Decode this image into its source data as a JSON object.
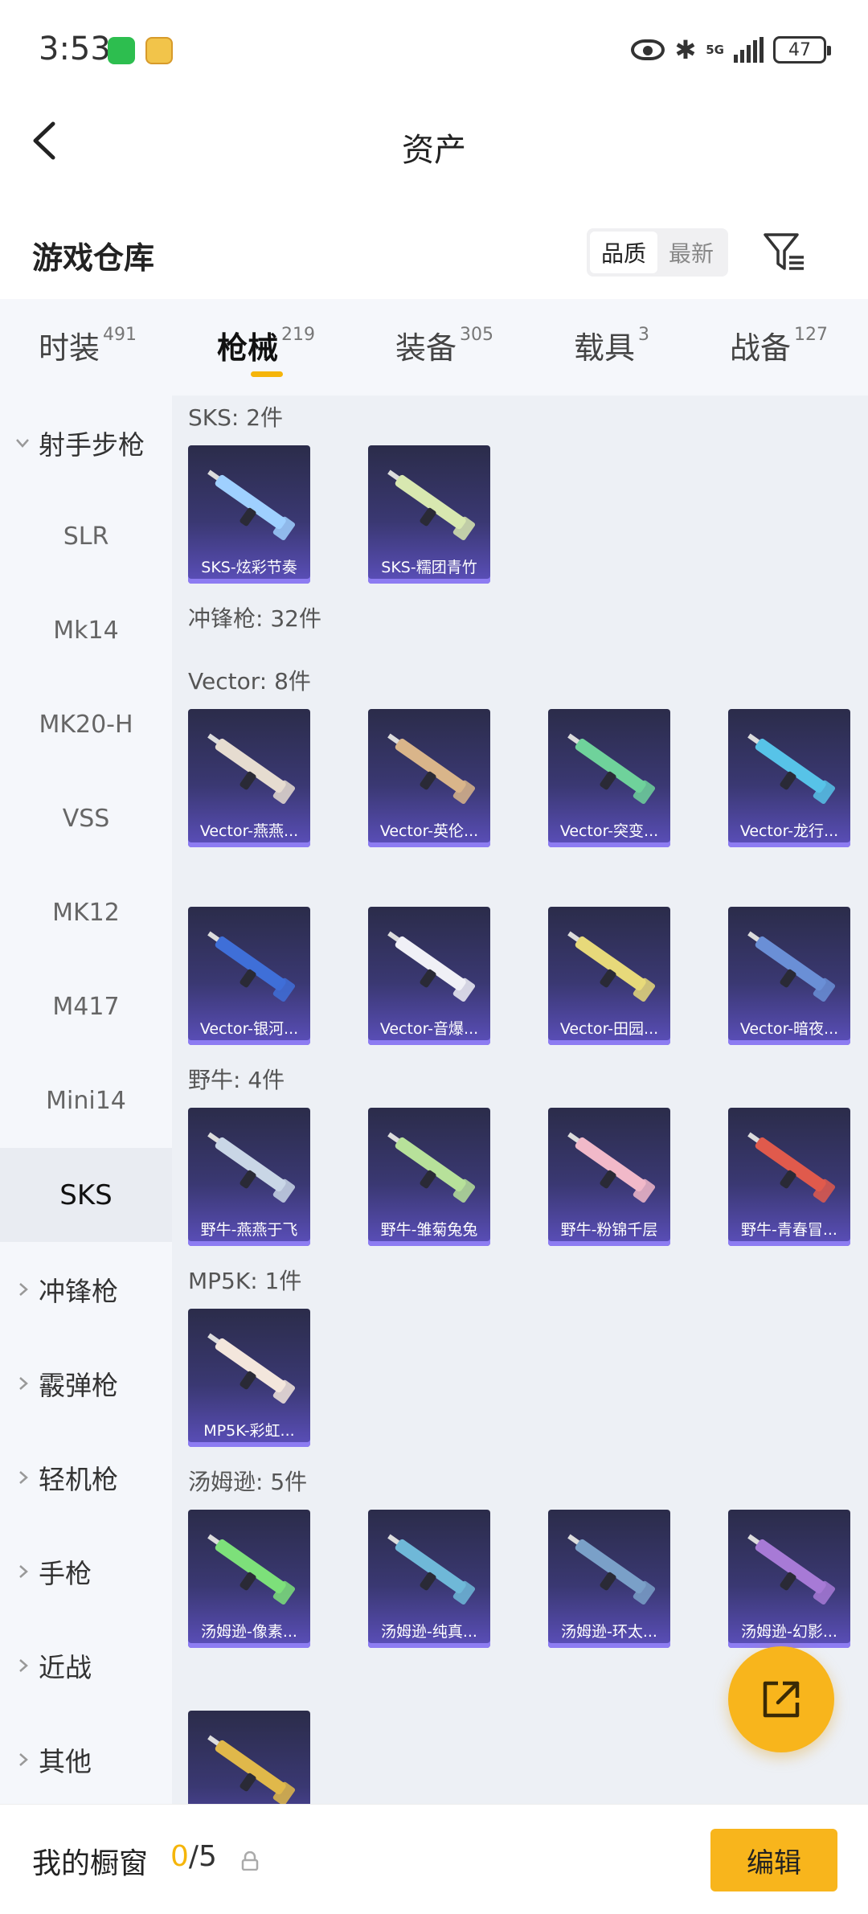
{
  "status_bar": {
    "time": "3:53",
    "network": "5G",
    "battery": "47"
  },
  "header": {
    "title": "资产"
  },
  "warehouse": {
    "title": "游戏仓库",
    "sort_options": [
      "品质",
      "最新"
    ],
    "active_sort": "品质"
  },
  "tabs": [
    {
      "label": "时装",
      "count": "491"
    },
    {
      "label": "枪械",
      "count": "219",
      "active": true
    },
    {
      "label": "装备",
      "count": "305"
    },
    {
      "label": "载具",
      "count": "3"
    },
    {
      "label": "战备",
      "count": "127"
    }
  ],
  "sidebar": {
    "category_open": "射手步枪",
    "subitems": [
      "SLR",
      "Mk14",
      "MK20-H",
      "VSS",
      "MK12",
      "M417",
      "Mini14",
      "SKS"
    ],
    "active_subitem": "SKS",
    "categories": [
      "冲锋枪",
      "霰弹枪",
      "轻机枪",
      "手枪",
      "近战",
      "其他"
    ]
  },
  "sections": [
    {
      "label": "SKS: 2件",
      "items": [
        {
          "name": "SKS-炫彩节奏",
          "color": "#9fd0ff"
        },
        {
          "name": "SKS-糯团青竹",
          "color": "#d8e8b0"
        }
      ]
    },
    {
      "label": "冲锋枪: 32件",
      "items": []
    },
    {
      "label": "Vector: 8件",
      "items": [
        {
          "name": "Vector-燕燕...",
          "color": "#e6dcd0"
        },
        {
          "name": "Vector-英伦...",
          "color": "#d9b58a"
        },
        {
          "name": "Vector-突变...",
          "color": "#6fd29b"
        },
        {
          "name": "Vector-龙行...",
          "color": "#57c3e8"
        },
        {
          "name": "Vector-银河...",
          "color": "#3f6fd8"
        },
        {
          "name": "Vector-音爆...",
          "color": "#f0f0f6"
        },
        {
          "name": "Vector-田园...",
          "color": "#e7d97a"
        },
        {
          "name": "Vector-暗夜...",
          "color": "#6a8fd6"
        }
      ]
    },
    {
      "label": "野牛: 4件",
      "items": [
        {
          "name": "野牛-燕燕于飞",
          "color": "#c9d6e6"
        },
        {
          "name": "野牛-雏菊兔兔",
          "color": "#b7e19a"
        },
        {
          "name": "野牛-粉锦千层",
          "color": "#f1b9c9"
        },
        {
          "name": "野牛-青春冒...",
          "color": "#e05a4c"
        }
      ]
    },
    {
      "label": "MP5K: 1件",
      "items": [
        {
          "name": "MP5K-彩虹...",
          "color": "#f3e6dc"
        }
      ]
    },
    {
      "label": "汤姆逊: 5件",
      "items": [
        {
          "name": "汤姆逊-像素...",
          "color": "#7de07a"
        },
        {
          "name": "汤姆逊-纯真...",
          "color": "#6fb8d8"
        },
        {
          "name": "汤姆逊-环太...",
          "color": "#7aa0c8"
        },
        {
          "name": "汤姆逊-幻影...",
          "color": "#a77ad6"
        },
        {
          "name": "",
          "color": "#e0b84a"
        }
      ]
    }
  ],
  "bottom_bar": {
    "showcase_label": "我的橱窗",
    "showcase_current": "0",
    "showcase_total": "/5",
    "edit_label": "编辑"
  }
}
